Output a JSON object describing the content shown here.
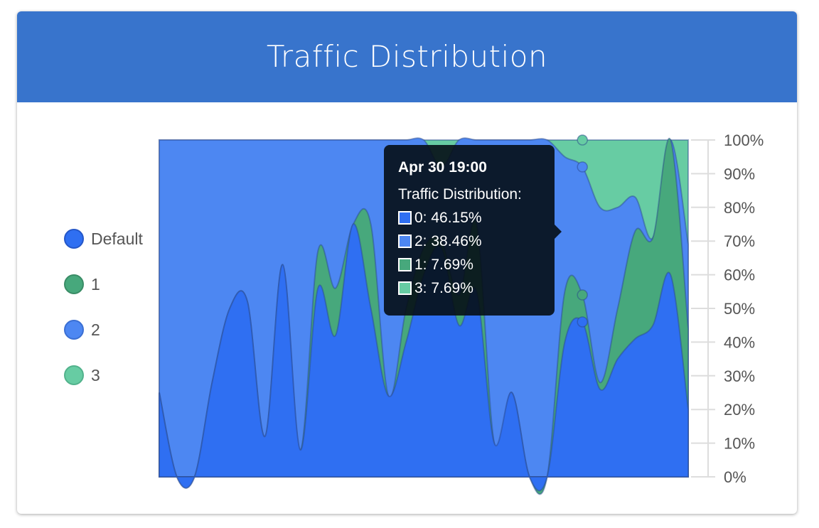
{
  "header": {
    "title": "Traffic Distribution"
  },
  "legend": [
    {
      "label": "Default",
      "color": "#2f6ff2",
      "border": "#2557c8"
    },
    {
      "label": "1",
      "color": "#47a87c",
      "border": "#3a8c66"
    },
    {
      "label": "2",
      "color": "#4d87f2",
      "border": "#3b6fd3"
    },
    {
      "label": "3",
      "color": "#67cca3",
      "border": "#52b28c"
    }
  ],
  "tooltip": {
    "date": "Apr 30 19:00",
    "title": "Traffic Distribution:",
    "rows": [
      {
        "text": "0: 46.15%",
        "color": "#2f6ff2"
      },
      {
        "text": "2: 38.46%",
        "color": "#4d87f2"
      },
      {
        "text": "1: 7.69%",
        "color": "#47a87c"
      },
      {
        "text": "3: 7.69%",
        "color": "#67cca3"
      }
    ]
  },
  "chart_data": {
    "type": "area",
    "stacked": true,
    "y_axis": {
      "ticks": [
        "0%",
        "10%",
        "20%",
        "30%",
        "40%",
        "50%",
        "60%",
        "70%",
        "80%",
        "90%",
        "100%"
      ],
      "position": "right",
      "ylim": [
        0,
        100
      ]
    },
    "x_axis": {
      "labels_shown": false
    },
    "series": [
      {
        "name": "Default",
        "color": "#2f6ff2",
        "values": [
          25,
          0,
          0,
          28,
          50,
          52,
          12,
          63,
          8,
          56,
          42,
          75,
          50,
          24,
          40,
          60,
          68,
          45,
          55,
          10,
          25,
          0,
          0,
          40,
          46,
          26,
          35,
          41,
          45,
          60,
          20
        ]
      },
      {
        "name": "1",
        "color": "#47a87c",
        "values": [
          0,
          0,
          0,
          0,
          0,
          0,
          0,
          0,
          0,
          11,
          14,
          0,
          25,
          0,
          10,
          8,
          2,
          9,
          20,
          0,
          0,
          0,
          0,
          15,
          8,
          2,
          15,
          32,
          26,
          40,
          24
        ]
      },
      {
        "name": "2",
        "color": "#4d87f2",
        "values": [
          75,
          100,
          100,
          72,
          50,
          48,
          88,
          37,
          92,
          33,
          44,
          25,
          25,
          76,
          50,
          32,
          22,
          46,
          25,
          90,
          75,
          100,
          100,
          40,
          38,
          52,
          30,
          10,
          0,
          0,
          25
        ]
      },
      {
        "name": "3",
        "color": "#67cca3",
        "values": [
          0,
          0,
          0,
          0,
          0,
          0,
          0,
          0,
          0,
          0,
          0,
          0,
          0,
          0,
          0,
          0,
          8,
          0,
          0,
          0,
          0,
          0,
          0,
          5,
          8,
          20,
          20,
          17,
          29,
          0,
          31
        ]
      }
    ],
    "highlight_index": 24
  }
}
